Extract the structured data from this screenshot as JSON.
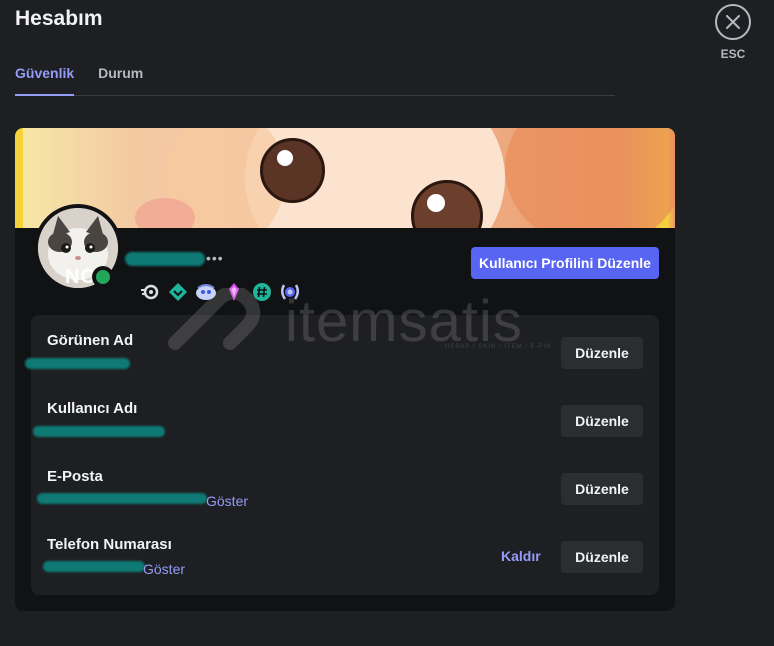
{
  "header": {
    "title": "Hesabım",
    "close_label": "ESC"
  },
  "tabs": [
    {
      "label": "Güvenlik",
      "active": true
    },
    {
      "label": "Durum",
      "active": false
    }
  ],
  "profile": {
    "avatar_initials": "NC",
    "username_suffix": "•••",
    "status": "online",
    "edit_button": "Kullanıcı Profilini Düzenle",
    "badges": [
      "nitro-badge-icon",
      "boost-badge-icon",
      "clyde-badge-icon",
      "gem-badge-icon",
      "hashtag-badge-icon",
      "laurel-badge-icon"
    ]
  },
  "fields": [
    {
      "label": "Görünen Ad",
      "edit": "Düzenle"
    },
    {
      "label": "Kullanıcı Adı",
      "edit": "Düzenle"
    },
    {
      "label": "E-Posta",
      "show": "Göster",
      "edit": "Düzenle"
    },
    {
      "label": "Telefon Numarası",
      "show": "Göster",
      "remove": "Kaldır",
      "edit": "Düzenle"
    }
  ],
  "watermark": {
    "brand": "itemsatis",
    "tagline": "HESAP / SKIN / ITEM / E-PIN"
  },
  "colors": {
    "accent": "#5865f2",
    "link": "#949cf7",
    "online": "#23a55a",
    "background": "#1e1f22",
    "card": "#111214"
  }
}
